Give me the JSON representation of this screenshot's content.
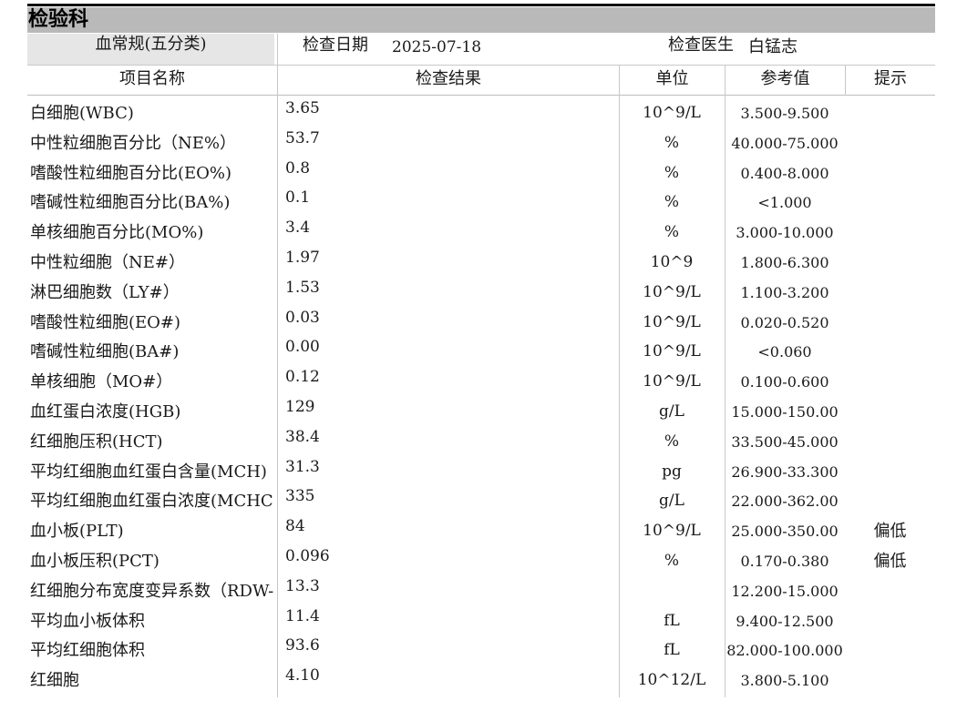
{
  "header": {
    "department": "检验科",
    "panel": "血常规(五分类)",
    "date_label": "检查日期",
    "date_value": "2025-07-18",
    "doctor_label": "检查医生",
    "doctor_value": "白锰志"
  },
  "columns": {
    "name": "项目名称",
    "result": "检查结果",
    "unit": "单位",
    "ref": "参考值",
    "hint": "提示"
  },
  "rows": [
    {
      "name": "白细胞(WBC)",
      "value": "3.65",
      "unit": "10^9/L",
      "ref": "3.500-9.500",
      "hint": ""
    },
    {
      "name": "中性粒细胞百分比（NE%）",
      "value": "53.7",
      "unit": "%",
      "ref": "40.000-75.000",
      "hint": ""
    },
    {
      "name": "嗜酸性粒细胞百分比(EO%)",
      "value": "0.8",
      "unit": "%",
      "ref": "0.400-8.000",
      "hint": ""
    },
    {
      "name": "嗜碱性粒细胞百分比(BA%)",
      "value": "0.1",
      "unit": "%",
      "ref": "<1.000",
      "hint": ""
    },
    {
      "name": "单核细胞百分比(MO%)",
      "value": "3.4",
      "unit": "%",
      "ref": "3.000-10.000",
      "hint": ""
    },
    {
      "name": "中性粒细胞（NE#）",
      "value": "1.97",
      "unit": "10^9",
      "ref": "1.800-6.300",
      "hint": ""
    },
    {
      "name": "淋巴细胞数（LY#）",
      "value": "1.53",
      "unit": "10^9/L",
      "ref": "1.100-3.200",
      "hint": ""
    },
    {
      "name": "嗜酸性粒细胞(EO#)",
      "value": "0.03",
      "unit": "10^9/L",
      "ref": "0.020-0.520",
      "hint": ""
    },
    {
      "name": "嗜碱性粒细胞(BA#)",
      "value": "0.00",
      "unit": "10^9/L",
      "ref": "<0.060",
      "hint": ""
    },
    {
      "name": "单核细胞（MO#）",
      "value": "0.12",
      "unit": "10^9/L",
      "ref": "0.100-0.600",
      "hint": ""
    },
    {
      "name": "血红蛋白浓度(HGB)",
      "value": "129",
      "unit": "g/L",
      "ref": "15.000-150.00",
      "hint": ""
    },
    {
      "name": "红细胞压积(HCT)",
      "value": "38.4",
      "unit": "%",
      "ref": "33.500-45.000",
      "hint": ""
    },
    {
      "name": "平均红细胞血红蛋白含量(MCH)",
      "value": "31.3",
      "unit": "pg",
      "ref": "26.900-33.300",
      "hint": ""
    },
    {
      "name": "平均红细胞血红蛋白浓度(MCHC",
      "value": "335",
      "unit": "g/L",
      "ref": "22.000-362.00",
      "hint": ""
    },
    {
      "name": "血小板(PLT)",
      "value": "84",
      "unit": "10^9/L",
      "ref": "25.000-350.00",
      "hint": "偏低"
    },
    {
      "name": "血小板压积(PCT)",
      "value": "0.096",
      "unit": "%",
      "ref": "0.170-0.380",
      "hint": "偏低"
    },
    {
      "name": "红细胞分布宽度变异系数（RDW-",
      "value": "13.3",
      "unit": "",
      "ref": "12.200-15.000",
      "hint": ""
    },
    {
      "name": "平均血小板体积",
      "value": "11.4",
      "unit": "fL",
      "ref": "9.400-12.500",
      "hint": ""
    },
    {
      "name": "平均红细胞体积",
      "value": "93.6",
      "unit": "fL",
      "ref": "82.000-100.000",
      "hint": ""
    },
    {
      "name": "红细胞",
      "value": "4.10",
      "unit": "10^12/L",
      "ref": "3.800-5.100",
      "hint": ""
    }
  ]
}
